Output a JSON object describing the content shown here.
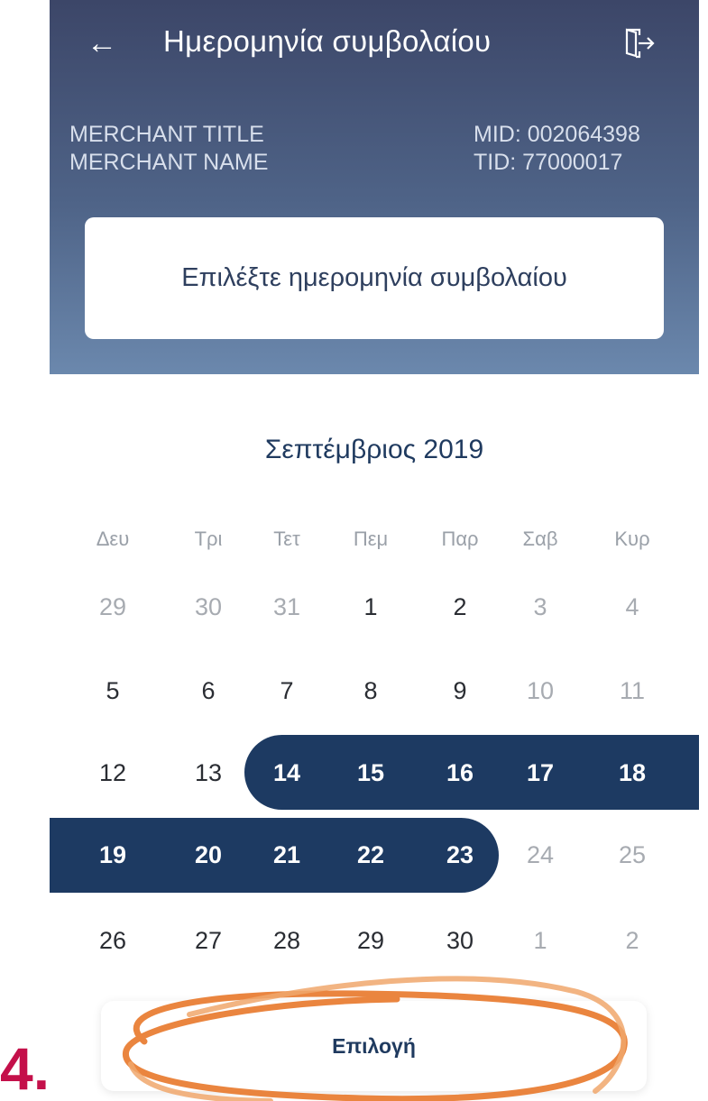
{
  "header": {
    "back_icon": "arrow-left-icon",
    "title": "Ημερομηνία συμβολαίου",
    "exit_icon": "logout-icon"
  },
  "merchant": {
    "title": "MERCHANT TITLE",
    "name": "MERCHANT NAME",
    "mid": "MID: 002064398",
    "tid": "TID: 77000017"
  },
  "date_select": {
    "label": "Επιλέξτε ημερομηνία συμβολαίου"
  },
  "calendar": {
    "month": "Σεπτέμβριος 2019",
    "weekdays": [
      "Δευ",
      "Τρι",
      "Τετ",
      "Πεμ",
      "Παρ",
      "Σαβ",
      "Κυρ"
    ],
    "weeks": [
      [
        "29",
        "30",
        "31",
        "1",
        "2",
        "3",
        "4"
      ],
      [
        "5",
        "6",
        "7",
        "8",
        "9",
        "10",
        "11"
      ],
      [
        "12",
        "13",
        "14",
        "15",
        "16",
        "17",
        "18"
      ],
      [
        "19",
        "20",
        "21",
        "22",
        "23",
        "24",
        "25"
      ],
      [
        "26",
        "27",
        "28",
        "29",
        "30",
        "1",
        "2"
      ]
    ],
    "muted": [
      [
        true,
        true,
        true,
        false,
        false,
        true,
        true
      ],
      [
        false,
        false,
        false,
        false,
        false,
        true,
        true
      ],
      [
        false,
        false,
        false,
        false,
        false,
        false,
        false
      ],
      [
        false,
        false,
        false,
        false,
        false,
        true,
        true
      ],
      [
        false,
        false,
        false,
        false,
        false,
        true,
        true
      ]
    ],
    "selected_range": {
      "start": "14",
      "end": "23"
    },
    "range_color": "#1d3a62"
  },
  "select_button": {
    "label": "Επιλογή"
  },
  "annotation": {
    "step": "4.",
    "step_color": "#c4104a",
    "circle_color": "#e8782a"
  }
}
